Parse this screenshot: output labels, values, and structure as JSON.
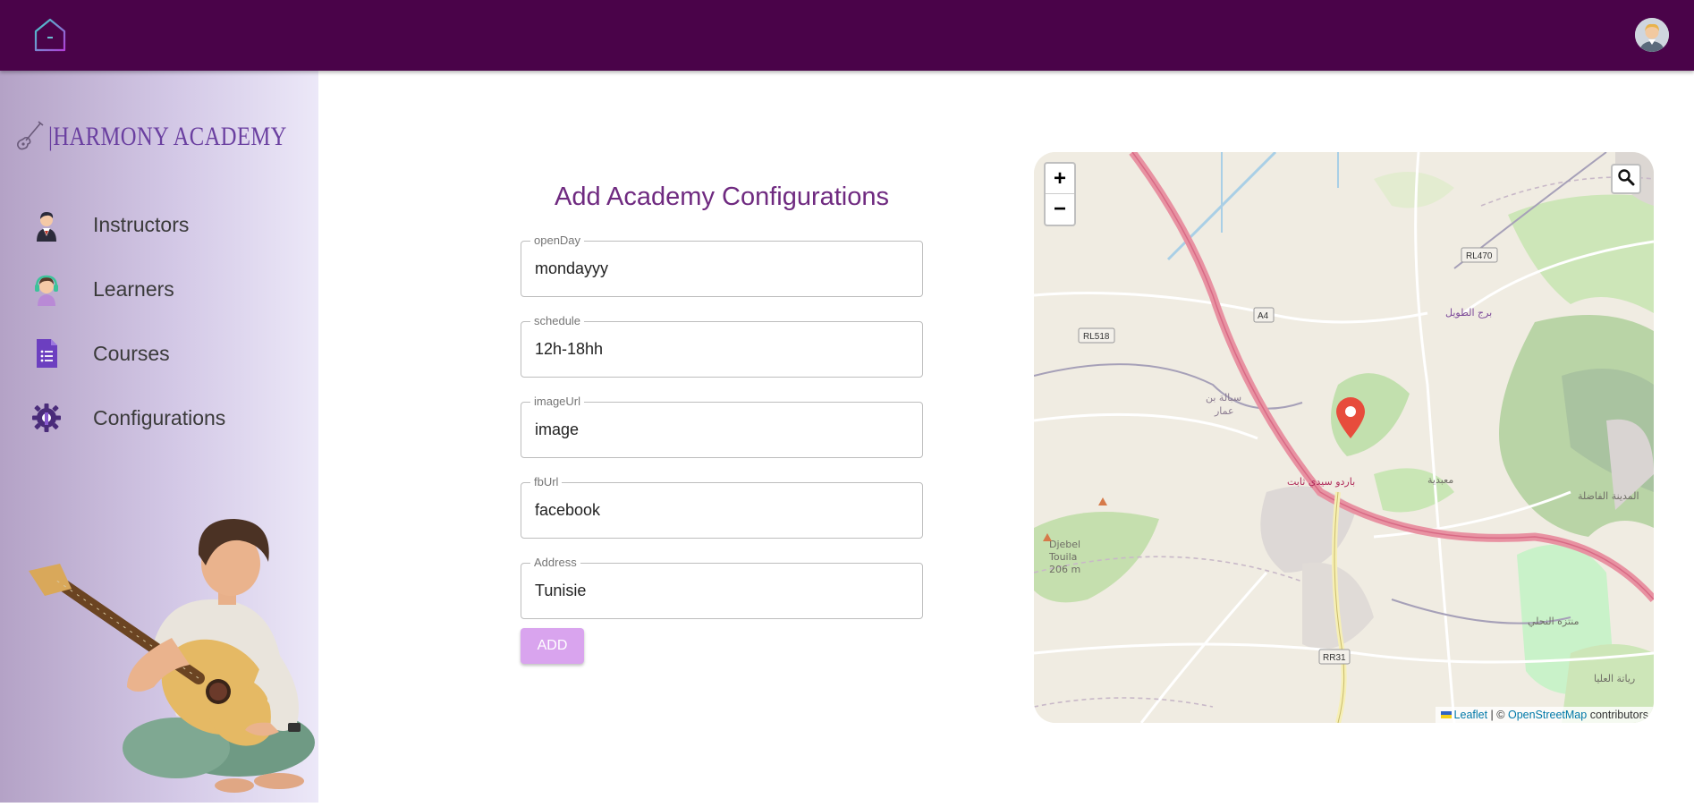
{
  "topbar": {
    "logo_icon": "house-icon",
    "avatar_icon": "user-avatar"
  },
  "sidebar": {
    "brand_text": "|HARMONY ACADEMY",
    "brand_icon": "guitar-icon",
    "items": [
      {
        "label": "Instructors",
        "icon": "instructor-icon"
      },
      {
        "label": "Learners",
        "icon": "learner-icon"
      },
      {
        "label": "Courses",
        "icon": "document-icon"
      },
      {
        "label": "Configurations",
        "icon": "gear-wrench-icon"
      }
    ]
  },
  "form": {
    "title": "Add Academy Configurations",
    "fields": [
      {
        "label": "openDay",
        "value": "mondayyy"
      },
      {
        "label": "schedule",
        "value": "12h-18hh"
      },
      {
        "label": "imageUrl",
        "value": "image"
      },
      {
        "label": "fbUrl",
        "value": "facebook"
      },
      {
        "label": "Address",
        "value": "Tunisie"
      }
    ],
    "submit_label": "ADD"
  },
  "map": {
    "zoom_in": "+",
    "zoom_out": "−",
    "labels": {
      "rl470": "RL470",
      "rl518": "RL518",
      "a4": "A4",
      "rr31": "RR31",
      "djebel": "Djebel",
      "touila": "Touila",
      "elev": "206 m",
      "borj": "برج الطويل",
      "sbalat": "سبالة بن",
      "ammar": "عمار",
      "bardo": "باردو سيدي ثابت",
      "madina": "المدينة الفاضلة",
      "mnazah": "منتزه النحلي",
      "aliya": "رياتة العليا",
      "mabdia": "معبدية"
    },
    "attribution": {
      "leaflet": "Leaflet",
      "sep": " | © ",
      "osm": "OpenStreetMap",
      "contrib": " contributors"
    }
  }
}
